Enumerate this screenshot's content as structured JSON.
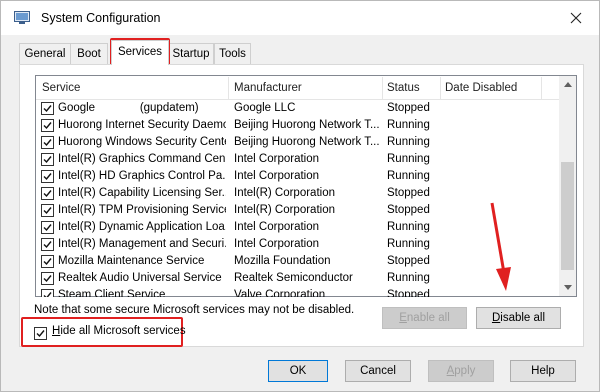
{
  "window": {
    "title": "System Configuration",
    "icons": {
      "app": "system-config-icon",
      "close": "close-icon"
    }
  },
  "tabs": [
    {
      "label": "General",
      "active": false
    },
    {
      "label": "Boot",
      "active": false
    },
    {
      "label": "Services",
      "active": true
    },
    {
      "label": "Startup",
      "active": false
    },
    {
      "label": "Tools",
      "active": false
    }
  ],
  "services": {
    "columns": [
      "Service",
      "Manufacturer",
      "Status",
      "Date Disabled"
    ],
    "rows": [
      {
        "service": "Google              (gupdatem)",
        "manufacturer": "Google LLC",
        "status": "Stopped",
        "date_disabled": "",
        "checked": true
      },
      {
        "service": "Huorong Internet Security Daemon",
        "manufacturer": "Beijing Huorong Network T...",
        "status": "Running",
        "date_disabled": "",
        "checked": true
      },
      {
        "service": "Huorong Windows Security Center",
        "manufacturer": "Beijing Huorong Network T...",
        "status": "Running",
        "date_disabled": "",
        "checked": true
      },
      {
        "service": "Intel(R) Graphics Command Cen...",
        "manufacturer": "Intel Corporation",
        "status": "Running",
        "date_disabled": "",
        "checked": true
      },
      {
        "service": "Intel(R) HD Graphics Control Pa...",
        "manufacturer": "Intel Corporation",
        "status": "Running",
        "date_disabled": "",
        "checked": true
      },
      {
        "service": "Intel(R) Capability Licensing Ser...",
        "manufacturer": "Intel(R) Corporation",
        "status": "Stopped",
        "date_disabled": "",
        "checked": true
      },
      {
        "service": "Intel(R) TPM Provisioning Service",
        "manufacturer": "Intel(R) Corporation",
        "status": "Stopped",
        "date_disabled": "",
        "checked": true
      },
      {
        "service": "Intel(R) Dynamic Application Loa...",
        "manufacturer": "Intel Corporation",
        "status": "Running",
        "date_disabled": "",
        "checked": true
      },
      {
        "service": "Intel(R) Management and Securi...",
        "manufacturer": "Intel Corporation",
        "status": "Running",
        "date_disabled": "",
        "checked": true
      },
      {
        "service": "Mozilla Maintenance Service",
        "manufacturer": "Mozilla Foundation",
        "status": "Stopped",
        "date_disabled": "",
        "checked": true
      },
      {
        "service": "Realtek Audio Universal Service",
        "manufacturer": "Realtek Semiconductor",
        "status": "Running",
        "date_disabled": "",
        "checked": true
      },
      {
        "service": "Steam Client Service",
        "manufacturer": "Valve Corporation",
        "status": "Stopped",
        "date_disabled": "",
        "checked": true
      }
    ],
    "scroll_icons": {
      "up": "scroll-up-arrow-icon",
      "down": "scroll-down-arrow-icon"
    }
  },
  "note": "Note that some secure Microsoft services may not be disabled.",
  "buttons": {
    "enable_all_prefix": "",
    "enable_all_ul": "E",
    "enable_all_rest": "nable all",
    "disable_all_ul": "D",
    "disable_all_rest": "isable all",
    "ok": "OK",
    "cancel": "Cancel",
    "apply_ul": "A",
    "apply_rest": "pply",
    "help": "Help"
  },
  "hide_ms": {
    "ul": "H",
    "rest": "ide all Microsoft services",
    "checked": true
  },
  "annotation": {
    "color": "#e02020"
  }
}
